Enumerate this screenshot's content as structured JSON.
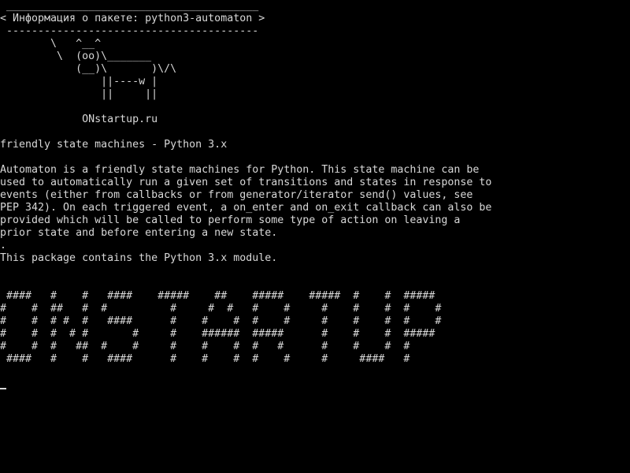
{
  "terminal": {
    "text_color": "#d8d8d8",
    "background_color": "#000000",
    "lines": [
      " ________________________________________",
      "< Информация о пакете: python3-automaton >",
      " ----------------------------------------",
      "        \\   ^__^",
      "         \\  (oo)\\_______",
      "            (__)\\       )\\/\\",
      "                ||----w |",
      "                ||     ||",
      "",
      "             ONstartup.ru",
      "",
      "friendly state machines - Python 3.x",
      "",
      "Automaton is a friendly state machines for Python. This state machine can be",
      "used to automatically run a given set of transitions and states in response to",
      "events (either from callbacks or from generator/iterator send() values, see",
      "PEP 342). On each triggered event, a on_enter and on_exit callback can also be",
      "provided which will be called to perform some type of action on leaving a",
      "prior state and before entering a new state.",
      ".",
      "This package contains the Python 3.x module.",
      "",
      "",
      " ####   #    #   ####    #####    ##    #####    #####  #    #  #####",
      "#    #  ##   #  #          #     #  #   #    #     #    #    #  #    #",
      "#    #  # #  #   ####      #    #    #  #    #     #    #    #  #    #",
      "#    #  #  # #       #     #    ######  #####      #    #    #  #####",
      "#    #  #   ##  #    #     #    #    #  #   #      #    #    #  #",
      " ####   #    #   ####      #    #    #  #    #     #     ####   #"
    ]
  }
}
